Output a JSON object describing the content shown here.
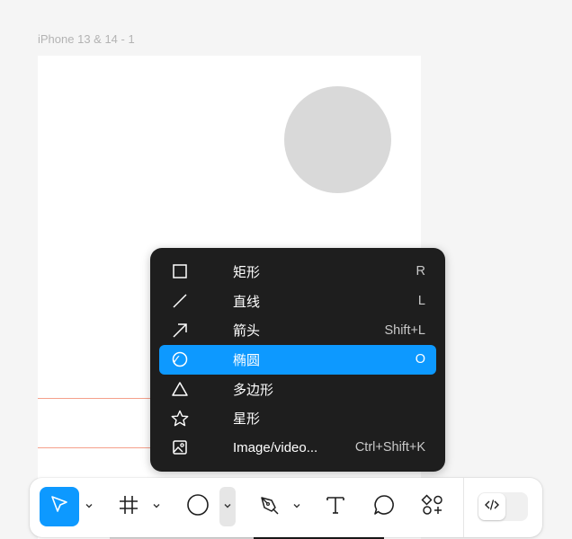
{
  "frame": {
    "label": "iPhone 13 & 14 - 1"
  },
  "menu": {
    "items": [
      {
        "icon": "rectangle-icon",
        "label": "矩形",
        "shortcut": "R",
        "checked": false,
        "active": false
      },
      {
        "icon": "line-icon",
        "label": "直线",
        "shortcut": "L",
        "checked": false,
        "active": false
      },
      {
        "icon": "arrow-icon",
        "label": "箭头",
        "shortcut": "Shift+L",
        "checked": false,
        "active": false
      },
      {
        "icon": "ellipse-icon",
        "label": "椭圆",
        "shortcut": "O",
        "checked": true,
        "active": true
      },
      {
        "icon": "polygon-icon",
        "label": "多边形",
        "shortcut": "",
        "checked": false,
        "active": false
      },
      {
        "icon": "star-icon",
        "label": "星形",
        "shortcut": "",
        "checked": false,
        "active": false
      },
      {
        "icon": "image-icon",
        "label": "Image/video...",
        "shortcut": "Ctrl+Shift+K",
        "checked": false,
        "active": false
      }
    ],
    "check_mark": "✓"
  },
  "toolbar": {
    "tools": [
      {
        "icon": "move-cursor-icon",
        "active": true
      },
      {
        "icon": "frame-hash-icon",
        "active": false
      },
      {
        "icon": "ellipse-icon",
        "active": false
      },
      {
        "icon": "pen-icon",
        "active": false
      },
      {
        "icon": "text-icon",
        "active": false
      },
      {
        "icon": "comment-icon",
        "active": false
      },
      {
        "icon": "resources-icon",
        "active": false
      },
      {
        "icon": "dev-mode-icon",
        "active": false
      }
    ]
  },
  "colors": {
    "accent": "#0d99ff",
    "menu_bg": "#1e1e1e",
    "canvas_bg": "#f5f5f5",
    "shape_fill": "#d9d9d9"
  }
}
